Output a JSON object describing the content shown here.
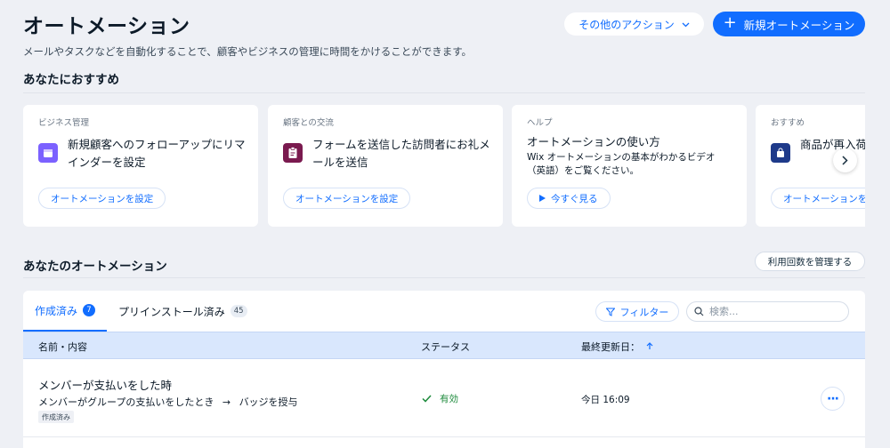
{
  "header": {
    "title": "オートメーション",
    "subtitle": "メールやタスクなどを自動化することで、顧客やビジネスの管理に時間をかけることができます。",
    "other_actions_label": "その他のアクション",
    "new_automation_label": "新規オートメーション"
  },
  "recommend": {
    "title": "あなたにおすすめ",
    "cards": [
      {
        "category": "ビジネス管理",
        "text": "新規顧客へのフォローアップにリマインダーを設定",
        "button": "オートメーションを設定",
        "icon": "calendar-icon",
        "icon_color": "#7b61ff"
      },
      {
        "category": "顧客との交流",
        "text": "フォームを送信した訪問者にお礼メールを送信",
        "button": "オートメーションを設定",
        "icon": "form-icon",
        "icon_color": "#7a1a4f"
      },
      {
        "category": "ヘルプ",
        "title": "オートメーションの使い方",
        "description": "Wix オートメーションの基本がわかるビデオ（英語）をご覧ください。",
        "button": "今すぐ見る",
        "icon": "play-icon"
      },
      {
        "category": "おすすめ",
        "text": "商品が再入荷",
        "button": "オートメーションを設定",
        "icon": "shopping-bag-icon",
        "icon_color": "#1e3a8a"
      }
    ]
  },
  "automations": {
    "title": "あなたのオートメーション",
    "manage_usage_label": "利用回数を管理する",
    "tabs": [
      {
        "label": "作成済み",
        "count": "7"
      },
      {
        "label": "プリインストール済み",
        "count": "45"
      }
    ],
    "filter_label": "フィルター",
    "search_placeholder": "検索...",
    "columns": {
      "name": "名前・内容",
      "status": "ステータス",
      "updated": "最終更新日："
    },
    "rows": [
      {
        "name": "メンバーが支払いをした時",
        "trigger": "メンバーがグループの支払いをしたとき",
        "arrow": "→",
        "action": "バッジを授与",
        "tag": "作成済み",
        "status": "有効",
        "updated": "今日 16:09"
      }
    ]
  },
  "colors": {
    "accent": "#116dff",
    "background": "#eef0f5",
    "active_status": "#1c8a3b"
  }
}
